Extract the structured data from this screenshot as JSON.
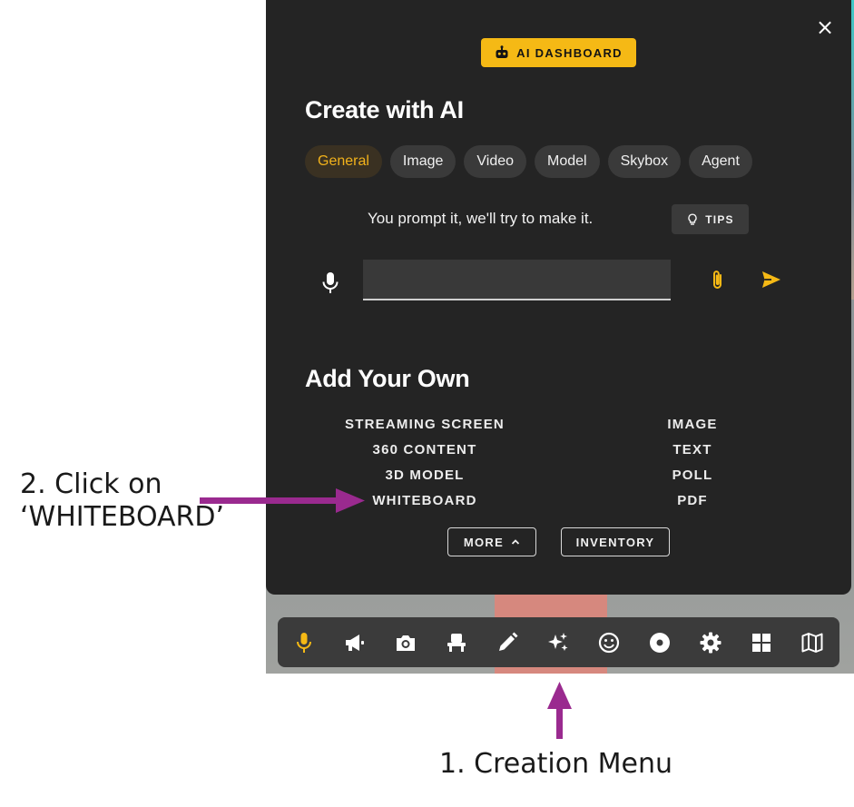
{
  "panel": {
    "close_symbol": "×",
    "ai_dashboard_label": "AI DASHBOARD",
    "create_heading": "Create with AI",
    "tabs": [
      {
        "label": "General",
        "active": true
      },
      {
        "label": "Image",
        "active": false
      },
      {
        "label": "Video",
        "active": false
      },
      {
        "label": "Model",
        "active": false
      },
      {
        "label": "Skybox",
        "active": false
      },
      {
        "label": "Agent",
        "active": false
      }
    ],
    "prompt_hint": "You prompt it, we'll try to make it.",
    "tips_label": "TIPS",
    "prompt_value": "",
    "add_heading": "Add Your Own",
    "own_left": [
      "STREAMING SCREEN",
      "360 CONTENT",
      "3D MODEL",
      "WHITEBOARD"
    ],
    "own_right": [
      "IMAGE",
      "TEXT",
      "POLL",
      "PDF"
    ],
    "more_label": "MORE",
    "inventory_label": "INVENTORY"
  },
  "toolbar": {
    "tools": [
      {
        "icon": "microphone-icon",
        "active": true
      },
      {
        "icon": "megaphone-icon",
        "active": false
      },
      {
        "icon": "camera-icon",
        "active": false
      },
      {
        "icon": "seat-icon",
        "active": false
      },
      {
        "icon": "pencil-icon",
        "active": false
      },
      {
        "icon": "sparkles-icon",
        "active": false
      },
      {
        "icon": "emoji-icon",
        "active": false
      },
      {
        "icon": "record-icon",
        "active": false
      },
      {
        "icon": "gear-icon",
        "active": false
      },
      {
        "icon": "grid-icon",
        "active": false
      },
      {
        "icon": "map-icon",
        "active": false
      }
    ]
  },
  "annotations": {
    "step2": [
      "2. Click on",
      "‘WHITEBOARD’"
    ],
    "step1": "1. Creation Menu"
  },
  "colors": {
    "accent": "#f5b915",
    "panel_bg": "#242424",
    "arrow": "#9a2a8f"
  }
}
